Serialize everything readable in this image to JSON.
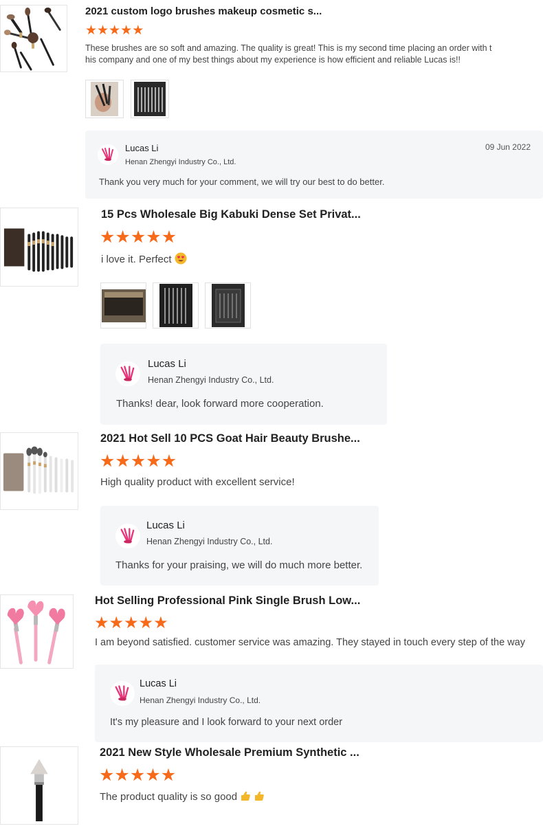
{
  "reviews": [
    {
      "title": "2021 custom logo brushes makeup cosmetic s...",
      "stars": 5,
      "text1": "These brushes are so soft and amazing. The quality is great! This is my second time placing an order with t",
      "text2": "his company and one of my best things about my experience is how efficient and reliable Lucas is!!",
      "photos": [
        "photo-brushes-in-hand",
        "photo-brush-set-case"
      ],
      "reply": {
        "name": "Lucas Li",
        "company": "Henan Zhengyi Industry Co., Ltd.",
        "date": "09 Jun 2022",
        "text": "Thank you very much for your comment, we will try our best to do better."
      }
    },
    {
      "title": "15 Pcs Wholesale Big Kabuki Dense Set Privat...",
      "stars": 5,
      "text1": "i love it. Perfect",
      "emoji": "heart-eyes-emoji",
      "photos": [
        "photo-package-box",
        "photo-black-brushes",
        "photo-brush-pouch"
      ],
      "reply": {
        "name": "Lucas Li",
        "company": "Henan Zhengyi Industry Co., Ltd.",
        "text": "Thanks! dear, look forward more cooperation."
      }
    },
    {
      "title": "2021 Hot Sell 10 PCS Goat Hair Beauty Brushe...",
      "stars": 5,
      "text1": "High quality product with excellent service!",
      "reply": {
        "name": "Lucas Li",
        "company": "Henan Zhengyi Industry Co., Ltd.",
        "text": "Thanks for your praising, we will do much more better."
      }
    },
    {
      "title": "Hot Selling Professional Pink Single Brush Low...",
      "stars": 5,
      "text1": "I am beyond satisfied. customer service was amazing. They stayed in touch every step of the way",
      "reply": {
        "name": "Lucas Li",
        "company": "Henan Zhengyi Industry Co., Ltd.",
        "text": "It's my pleasure and I look forward to your next order"
      }
    },
    {
      "title": "2021 New Style Wholesale Premium Synthetic ...",
      "stars": 5,
      "text1": "The product quality is so good",
      "emoji": "thumbs-up-emoji"
    }
  ],
  "colors": {
    "star": "#f76a1a",
    "reply_bg": "#f5f6f7",
    "avatar_brush": "#e8347a"
  }
}
